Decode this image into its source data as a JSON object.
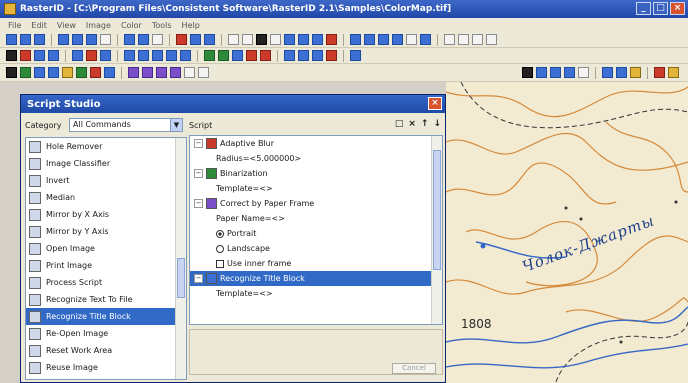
{
  "window": {
    "title": "RasterID - [C:\\Program Files\\Consistent Software\\RasterID 2.1\\Samples\\ColorMap.tif]",
    "controls": [
      "_",
      "□",
      "×"
    ]
  },
  "menu": [
    "File",
    "Edit",
    "View",
    "Image",
    "Color",
    "Tools",
    "Help"
  ],
  "dialog": {
    "title": "Script Studio",
    "close": "×",
    "category_label": "Category",
    "category_value": "All Commands",
    "script_label": "Script",
    "script_tools": [
      "□",
      "×",
      "↑",
      "↓"
    ],
    "commands": [
      {
        "label": "Hole Remover",
        "icon": "hole-remover-icon",
        "selected": false
      },
      {
        "label": "Image Classifier",
        "icon": "image-classifier-icon",
        "selected": false
      },
      {
        "label": "Invert",
        "icon": "invert-icon",
        "selected": false
      },
      {
        "label": "Median",
        "icon": "median-icon",
        "selected": false
      },
      {
        "label": "Mirror by X Axis",
        "icon": "mirror-x-icon",
        "selected": false
      },
      {
        "label": "Mirror by Y Axis",
        "icon": "mirror-y-icon",
        "selected": false
      },
      {
        "label": "Open Image",
        "icon": "open-image-icon",
        "selected": false
      },
      {
        "label": "Print Image",
        "icon": "print-image-icon",
        "selected": false
      },
      {
        "label": "Process Script",
        "icon": "process-script-icon",
        "selected": false
      },
      {
        "label": "Recognize Text To File",
        "icon": "recognize-text-icon",
        "selected": false
      },
      {
        "label": "Recognize Title Block",
        "icon": "recognize-title-icon",
        "selected": true
      },
      {
        "label": "Re-Open Image",
        "icon": "reopen-image-icon",
        "selected": false
      },
      {
        "label": "Reset Work Area",
        "icon": "reset-work-area-icon",
        "selected": false
      },
      {
        "label": "Reuse Image",
        "icon": "reuse-image-icon",
        "selected": false
      }
    ],
    "script_nodes": [
      {
        "type": "node",
        "label": "Adaptive Blur",
        "exp": "−",
        "color": "#c73a2a"
      },
      {
        "type": "param",
        "label": "Radius=<5.000000>"
      },
      {
        "type": "node",
        "label": "Binarization",
        "exp": "−",
        "color": "#2d8a3a"
      },
      {
        "type": "param",
        "label": "Template=<>"
      },
      {
        "type": "node",
        "label": "Correct by Paper Frame",
        "exp": "−",
        "color": "#7b4fc9"
      },
      {
        "type": "param",
        "label": "Paper Name=<>"
      },
      {
        "type": "radio",
        "label": "Portrait",
        "on": true
      },
      {
        "type": "radio",
        "label": "Landscape",
        "on": false
      },
      {
        "type": "check",
        "label": "Use inner frame"
      },
      {
        "type": "node",
        "label": "Recognize Title Block",
        "exp": "−",
        "color": "#3b6fd4",
        "selected": true
      },
      {
        "type": "param",
        "label": "Template=<>"
      }
    ],
    "cancel_label": "Cancel"
  },
  "map": {
    "place_name": "Чолок-Джарты",
    "elevation": "1808"
  }
}
